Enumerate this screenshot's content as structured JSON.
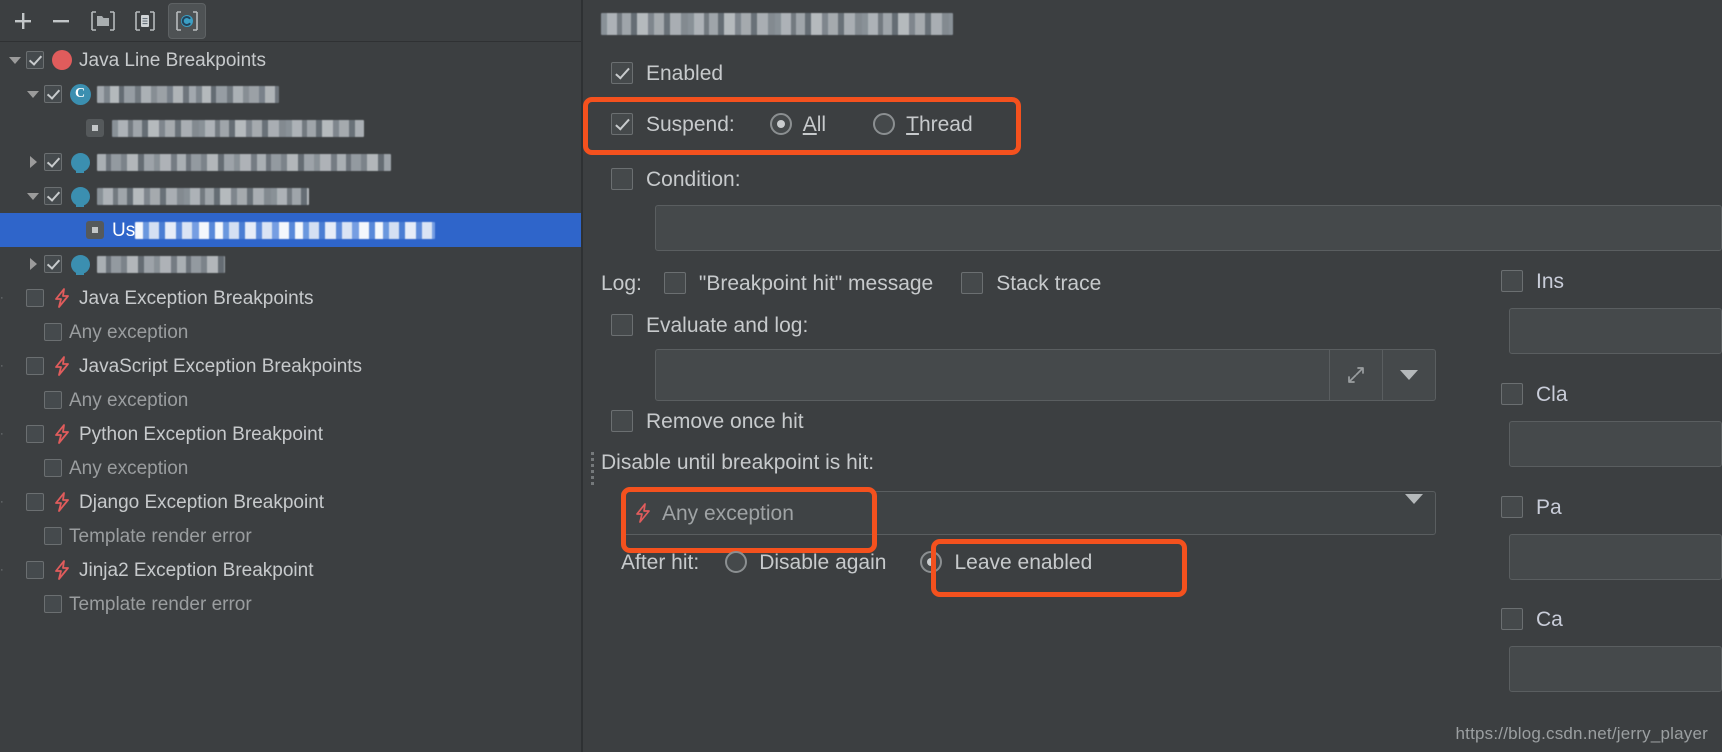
{
  "toolbar": {
    "buttons": [
      {
        "name": "add-breakpoint-button",
        "glyph": "+",
        "active": false
      },
      {
        "name": "remove-breakpoint-button",
        "glyph": "−",
        "active": false
      },
      {
        "name": "group-by-folder-button",
        "glyph": "folder-icon",
        "active": false
      },
      {
        "name": "view-breakpoint-source-button",
        "glyph": "file-icon",
        "active": false
      },
      {
        "name": "group-by-class-button",
        "glyph": "class-c-icon",
        "active": true
      }
    ]
  },
  "tree": {
    "rows": [
      {
        "label": "Java Line Breakpoints",
        "checked": true,
        "twisty": "down",
        "icon": "red-dot-icon",
        "indent": 0,
        "redacted": false,
        "selected": false,
        "dim": false
      },
      {
        "label": "",
        "checked": true,
        "twisty": "down",
        "icon": "class-c-icon",
        "indent": 1,
        "redacted": true,
        "redact_width": 182,
        "redact_style": "",
        "selected": false,
        "dim": false
      },
      {
        "label": "",
        "checked": null,
        "twisty": "none",
        "icon": "stamp-icon",
        "indent": 2,
        "redacted": true,
        "redact_width": 252,
        "redact_style": "r2",
        "selected": false,
        "dim": false
      },
      {
        "label": "",
        "checked": true,
        "twisty": "right",
        "icon": "breakpoint-icon",
        "indent": 1,
        "redacted": true,
        "redact_width": 294,
        "redact_style": "r3",
        "selected": false,
        "dim": false
      },
      {
        "label": "",
        "checked": true,
        "twisty": "down",
        "icon": "breakpoint-icon",
        "indent": 1,
        "redacted": true,
        "redact_width": 212,
        "redact_style": "r2",
        "selected": false,
        "dim": false
      },
      {
        "label": "",
        "checked": null,
        "twisty": "none",
        "icon": "stamp-icon",
        "indent": 2,
        "redacted": true,
        "redact_width": 300,
        "redact_style": "onsel",
        "selected": true,
        "dim": false,
        "prefix": "Us"
      },
      {
        "label": "",
        "checked": true,
        "twisty": "right",
        "icon": "breakpoint-icon",
        "indent": 1,
        "redacted": true,
        "redact_width": 128,
        "redact_style": "r3",
        "selected": false,
        "dim": false
      },
      {
        "label": "Java Exception Breakpoints",
        "checked": false,
        "twisty": "none",
        "icon": "bolt-icon",
        "indent": 0,
        "redacted": false,
        "selected": false,
        "dim": false
      },
      {
        "label": "Any exception",
        "checked": false,
        "twisty": "none",
        "icon": "none",
        "indent": 1,
        "redacted": false,
        "selected": false,
        "dim": true
      },
      {
        "label": "JavaScript Exception Breakpoints",
        "checked": false,
        "twisty": "none",
        "icon": "bolt-icon",
        "indent": 0,
        "redacted": false,
        "selected": false,
        "dim": false
      },
      {
        "label": "Any exception",
        "checked": false,
        "twisty": "none",
        "icon": "none",
        "indent": 1,
        "redacted": false,
        "selected": false,
        "dim": true
      },
      {
        "label": "Python Exception Breakpoint",
        "checked": false,
        "twisty": "none",
        "icon": "bolt-icon",
        "indent": 0,
        "redacted": false,
        "selected": false,
        "dim": false
      },
      {
        "label": "Any exception",
        "checked": false,
        "twisty": "none",
        "icon": "none",
        "indent": 1,
        "redacted": false,
        "selected": false,
        "dim": true
      },
      {
        "label": "Django Exception Breakpoint",
        "checked": false,
        "twisty": "none",
        "icon": "bolt-icon",
        "indent": 0,
        "redacted": false,
        "selected": false,
        "dim": false
      },
      {
        "label": "Template render error",
        "checked": false,
        "twisty": "none",
        "icon": "none",
        "indent": 1,
        "redacted": false,
        "selected": false,
        "dim": true
      },
      {
        "label": "Jinja2 Exception Breakpoint",
        "checked": false,
        "twisty": "none",
        "icon": "bolt-icon",
        "indent": 0,
        "redacted": false,
        "selected": false,
        "dim": false
      },
      {
        "label": "Template render error",
        "checked": false,
        "twisty": "none",
        "icon": "none",
        "indent": 1,
        "redacted": false,
        "selected": false,
        "dim": true
      }
    ]
  },
  "details": {
    "title_redacted": true,
    "enabled": {
      "label": "Enabled",
      "checked": true
    },
    "suspend": {
      "label": "Suspend:",
      "checked": true,
      "options": [
        {
          "label": "All",
          "mnemonic": "A",
          "selected": true
        },
        {
          "label": "Thread",
          "mnemonic": "T",
          "selected": false
        }
      ],
      "highlighted": true
    },
    "condition": {
      "label": "Condition:",
      "checked": false,
      "value": ""
    },
    "log": {
      "label": "Log:",
      "breakpoint_hit_message": {
        "label": "\"Breakpoint hit\" message",
        "checked": false
      },
      "stack_trace": {
        "label": "Stack trace",
        "checked": false
      }
    },
    "evaluate_and_log": {
      "label": "Evaluate and log:",
      "checked": false,
      "value": ""
    },
    "remove_once_hit": {
      "label": "Remove once hit",
      "checked": false
    },
    "disable_until": {
      "label": "Disable until breakpoint is hit:",
      "selected_value": "Any exception",
      "value_icon": "bolt-icon",
      "highlighted": true
    },
    "after_hit": {
      "label": "After hit:",
      "options": [
        {
          "label": "Disable again",
          "selected": false,
          "highlighted": false
        },
        {
          "label": "Leave enabled",
          "selected": true,
          "highlighted": true
        }
      ]
    },
    "filters": [
      {
        "label": "Ins",
        "full": "Instance filters",
        "checked": false,
        "value": ""
      },
      {
        "label": "Cla",
        "full": "Class filters",
        "checked": false,
        "value": ""
      },
      {
        "label": "Pa",
        "full": "Pass count",
        "checked": false,
        "value": ""
      },
      {
        "label": "Ca",
        "full": "Caller filters",
        "checked": false,
        "value": ""
      }
    ]
  },
  "watermark": {
    "text": "https://blog.csdn.net/jerry_player"
  },
  "colors": {
    "background": "#3c3f41",
    "selection_blue": "#2f65ca",
    "highlight_orange": "#f4511e",
    "breakpoint_red": "#e05c5c",
    "icon_teal": "#3b8fb0",
    "text": "#c7cacc"
  }
}
